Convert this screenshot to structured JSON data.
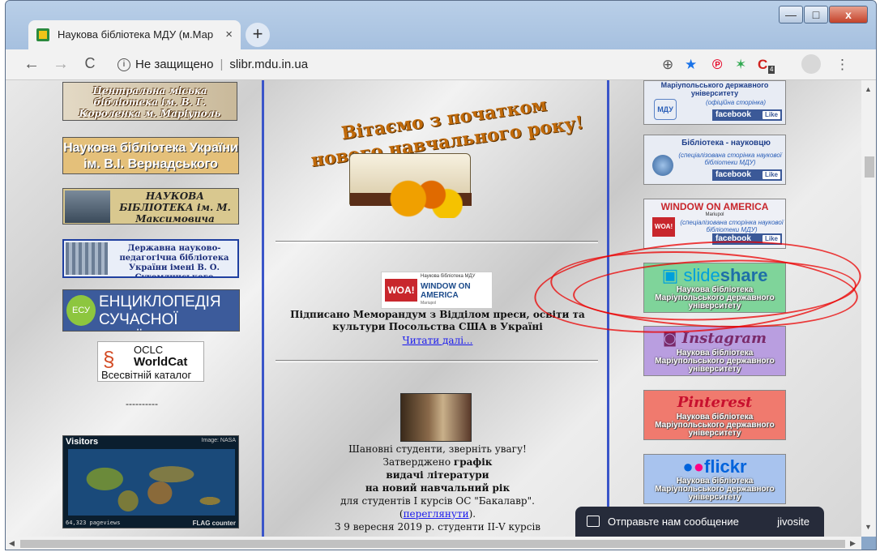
{
  "browser": {
    "tab_title": "Наукова бібліотека МДУ (м.Мар",
    "tab_close": "×",
    "new_tab": "+",
    "win_minimize": "—",
    "win_maximize": "□",
    "win_close": "x",
    "nav_back": "←",
    "nav_forward": "→",
    "nav_reload": "C",
    "security_label": "Не защищено",
    "address_sep": "|",
    "url": "slibr.mdu.in.ua",
    "zoom_icon": "⊕",
    "star_icon": "★",
    "pinterest_ext": "℗",
    "ext_badge": "4",
    "menu_icon": "⋮"
  },
  "left_links": {
    "lib1": "Центральна міська бібліотека ім. В. Г. Короленка м. Маріуполь",
    "lib2": "Наукова бібліотека України ім. В.І. Вернадського",
    "lib3": "НАУКОВА БІБЛІОТЕКА ім. М. Максимовича",
    "lib4": "Державна науково-педагогічна бібліотека України імені В. О. Сухомлинського",
    "ency_logo": "ЕСУ",
    "ency_line1": "ЕНЦИКЛОПЕДІЯ",
    "ency_line2": "СУЧАСНОЇ УКРАЇНИ",
    "worldcat_line1": "OCLC",
    "worldcat_line2": "WorldCat",
    "worldcat_line3": "Всесвітній каталог",
    "dashes": "----------",
    "visitors_title": "Visitors",
    "visitors_image": "Image: NASA",
    "visitors_count": "64,323 pageviews",
    "visitors_brand": "FLAG counter"
  },
  "center": {
    "welcome_line1": "Вітаємо з початком",
    "welcome_line2": "нового навчального року!",
    "woa_header": "Наукова бібліотека МДУ",
    "woa_logo": "WOA!",
    "woa_main": "WINDOW ON AMERICA",
    "woa_sub": "Mariupol",
    "memo_text": "Підписано Меморандум з Відділом преси, освіти та культури Посольства США в Україні",
    "read_more": "Читати далі...",
    "notice_line1": "Шановні студенти, зверніть увагу!",
    "notice_line2a": "Затверджено",
    "notice_line2b": "графік",
    "notice_line3": "видачі літератури",
    "notice_line4": "на новий навчальний рік",
    "notice_line5": "для студентів І курсів ОС \"Бакалавр\".",
    "notice_line6a": "(",
    "notice_link": "переглянути",
    "notice_line6b": ").",
    "notice_line7": "З 9 вересня 2019 р. студенти ІІ-V курсів"
  },
  "right_links": {
    "mdu_title": "Маріупольського державного університету",
    "mdu_logo": "МДУ",
    "mdu_sub": "(офіційна сторінка)",
    "bib_title": "Бібліотека - науковцю",
    "bib_sub": "(спеціалізована сторінка наукової бібліотеки МДУ)",
    "woa_title": "WINDOW ON AMERICA",
    "woa_small": "Mariupol",
    "woa_logo": "WOA!",
    "woa_sub": "(спеціалізована сторінка наукової бібліотеки МДУ)",
    "facebook": "facebook",
    "like": "Like",
    "slideshare_a": "slide",
    "slideshare_b": "share",
    "instagram": "Instagram",
    "pinterest": "Pinterest",
    "flickr": "flickr",
    "banner_caption": "Наукова бібліотека Маріупольського державного університету"
  },
  "chat": {
    "text": "Отправьте нам сообщение",
    "brand": "jivosite"
  },
  "scroll": {
    "up": "▲",
    "down": "▼",
    "left": "◀",
    "right": "▶"
  }
}
